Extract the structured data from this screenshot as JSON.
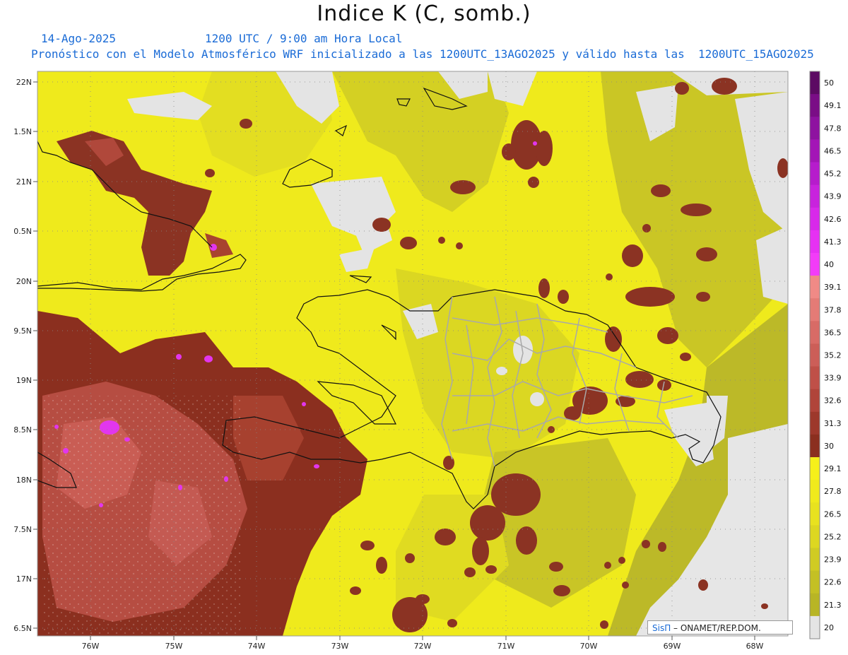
{
  "title": "Indice K (C, somb.)",
  "date": "14-Ago-2025",
  "time": "1200 UTC / 9:00 am Hora Local",
  "forecast_line": "Pronóstico con el Modelo Atmosférico WRF inicializado a las 1200UTC_13AGO2025 y válido hasta las  1200UTC_15AGO2025",
  "lat_labels": [
    "22N",
    "1.5N",
    "21N",
    "0.5N",
    "20N",
    "9.5N",
    "19N",
    "8.5N",
    "18N",
    "7.5N",
    "17N",
    "6.5N"
  ],
  "lon_labels": [
    "76W",
    "75W",
    "74W",
    "73W",
    "72W",
    "71W",
    "70W",
    "69W",
    "68W"
  ],
  "colorbar": {
    "values": [
      "50",
      "49.1",
      "47.8",
      "46.5",
      "45.2",
      "43.9",
      "42.6",
      "41.3",
      "40",
      "39.1",
      "37.8",
      "36.5",
      "35.2",
      "33.9",
      "32.6",
      "31.3",
      "30",
      "29.1",
      "27.8",
      "26.5",
      "25.2",
      "23.9",
      "22.6",
      "21.3",
      "20"
    ],
    "colors": [
      "#5c0a63",
      "#7a0d86",
      "#8e12a0",
      "#a316b6",
      "#b61ccc",
      "#c823dd",
      "#d829ea",
      "#e631f3",
      "#f23cf8",
      "#f08a86",
      "#e47b76",
      "#d86b66",
      "#cc5e58",
      "#bf5048",
      "#b0443a",
      "#9d382b",
      "#8b2f1f",
      "#f6f01a",
      "#f0ea1c",
      "#e8e21f",
      "#ddd721",
      "#d0cb23",
      "#c4c024",
      "#b8b525",
      "#e4e4e4"
    ]
  },
  "map_colors": {
    "land_fill": "#e2e2e2",
    "low_k": "#b9b62a",
    "mid_k": "#dcd825",
    "high_k": "#f4ee1a",
    "very_high_k": "#8a3020",
    "extreme_k": "#e236ee"
  },
  "credit": {
    "brand": "SisΠ",
    "text": " – ONAMET/REP.DOM."
  }
}
